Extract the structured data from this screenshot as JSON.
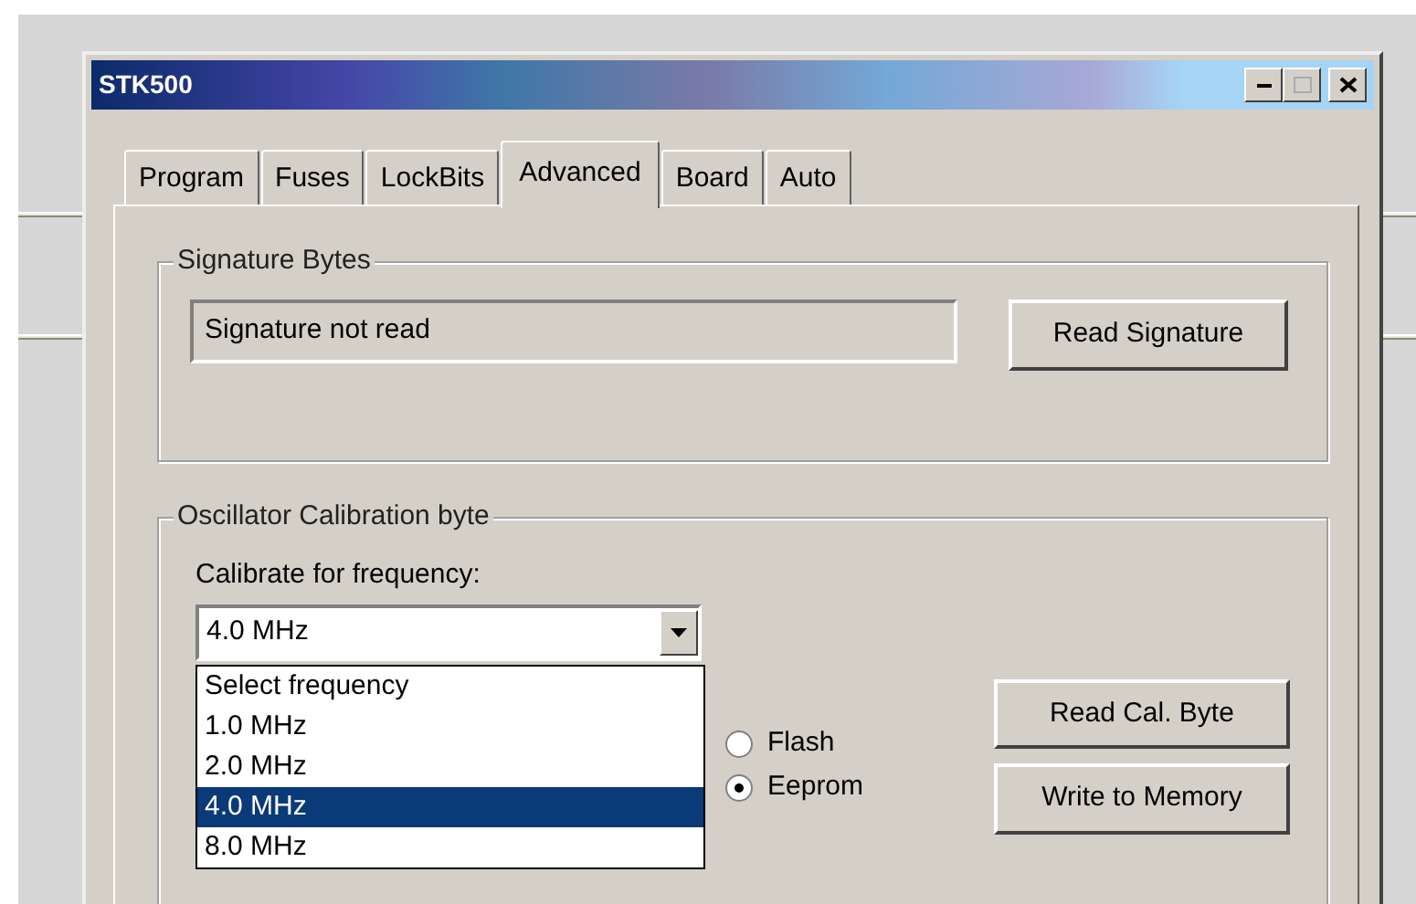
{
  "window": {
    "title": "STK500"
  },
  "tabs": [
    {
      "label": "Program",
      "selected": false
    },
    {
      "label": "Fuses",
      "selected": false
    },
    {
      "label": "LockBits",
      "selected": false
    },
    {
      "label": "Advanced",
      "selected": true
    },
    {
      "label": "Board",
      "selected": false
    },
    {
      "label": "Auto",
      "selected": false
    }
  ],
  "signature_group": {
    "title": "Signature Bytes",
    "field_value": "Signature not read",
    "button": "Read Signature"
  },
  "oscillator_group": {
    "title": "Oscillator Calibration byte",
    "label": "Calibrate for frequency:",
    "frequency_combo": {
      "value": "4.0 MHz",
      "expanded": true,
      "options": [
        {
          "label": "Select frequency",
          "selected": false
        },
        {
          "label": "1.0 MHz",
          "selected": false
        },
        {
          "label": "2.0 MHz",
          "selected": false
        },
        {
          "label": "4.0 MHz",
          "selected": true
        },
        {
          "label": "8.0 MHz",
          "selected": false
        }
      ]
    },
    "target": [
      {
        "label": "Flash",
        "checked": false
      },
      {
        "label": "Eeprom",
        "checked": true
      }
    ],
    "buttons": [
      "Read Cal. Byte",
      "Write to Memory"
    ]
  }
}
